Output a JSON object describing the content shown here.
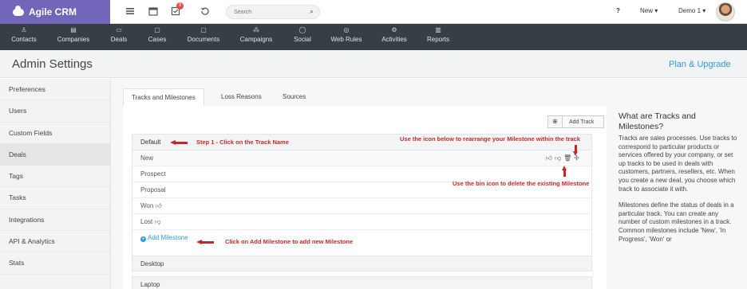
{
  "brand": {
    "name": "Agile CRM"
  },
  "topbar": {
    "notification_count": "9",
    "search_placeholder": "Search",
    "new_label": "New",
    "user_label": "Demo 1"
  },
  "nav": [
    {
      "label": "Contacts",
      "icon": "contacts-icon"
    },
    {
      "label": "Companies",
      "icon": "companies-icon"
    },
    {
      "label": "Deals",
      "icon": "deals-icon"
    },
    {
      "label": "Cases",
      "icon": "cases-icon"
    },
    {
      "label": "Documents",
      "icon": "documents-icon"
    },
    {
      "label": "Campaigns",
      "icon": "campaigns-icon"
    },
    {
      "label": "Social",
      "icon": "social-icon"
    },
    {
      "label": "Web Rules",
      "icon": "web-rules-icon"
    },
    {
      "label": "Activities",
      "icon": "activities-icon"
    },
    {
      "label": "Reports",
      "icon": "reports-icon"
    }
  ],
  "header": {
    "title": "Admin Settings",
    "plan_link": "Plan & Upgrade"
  },
  "sidebar": {
    "items": [
      {
        "label": "Preferences"
      },
      {
        "label": "Users"
      },
      {
        "label": "Custom Fields"
      },
      {
        "label": "Deals"
      },
      {
        "label": "Tags"
      },
      {
        "label": "Tasks"
      },
      {
        "label": "Integrations"
      },
      {
        "label": "API & Analytics"
      },
      {
        "label": "Stats"
      }
    ],
    "active": "Deals"
  },
  "tabs": [
    {
      "label": "Tracks and Milestones"
    },
    {
      "label": "Loss Reasons"
    },
    {
      "label": "Sources"
    }
  ],
  "add_track_label": "Add Track",
  "track": {
    "name": "Default",
    "milestones": [
      {
        "label": "New"
      },
      {
        "label": "Prospect"
      },
      {
        "label": "Proposal"
      },
      {
        "label": "Won"
      },
      {
        "label": "Lost"
      }
    ],
    "add_milestone_label": "Add Milestone"
  },
  "other_tracks": [
    {
      "name": "Desktop"
    },
    {
      "name": "Laptop"
    }
  ],
  "annotations": {
    "step1": "Step 1 - Click on the Track Name",
    "rearrange": "Use the icon below to rearrange your Milestone within the track",
    "bin": "Use the bin icon to delete the existing Milestone",
    "add_milestone": "Click on Add Milestone to add new Milestone"
  },
  "help": {
    "title": "What are Tracks and Milestones?",
    "para1": "Tracks are sales processes. Use tracks to correspond to particular products or services offered by your company, or set up tracks to be used in deals with customers, partners, resellers, etc. When you create a new deal, you choose which track to associate it with.",
    "para2": "Milestones define the status of deals in a particular track. You can create any number of custom milestones in a track. Common milestones include 'New', 'In Progress', 'Won' or"
  },
  "colors": {
    "brand": "#7266ba",
    "navbar": "#363f44",
    "link": "#2d9bd0",
    "annotation": "#c22a2a"
  }
}
